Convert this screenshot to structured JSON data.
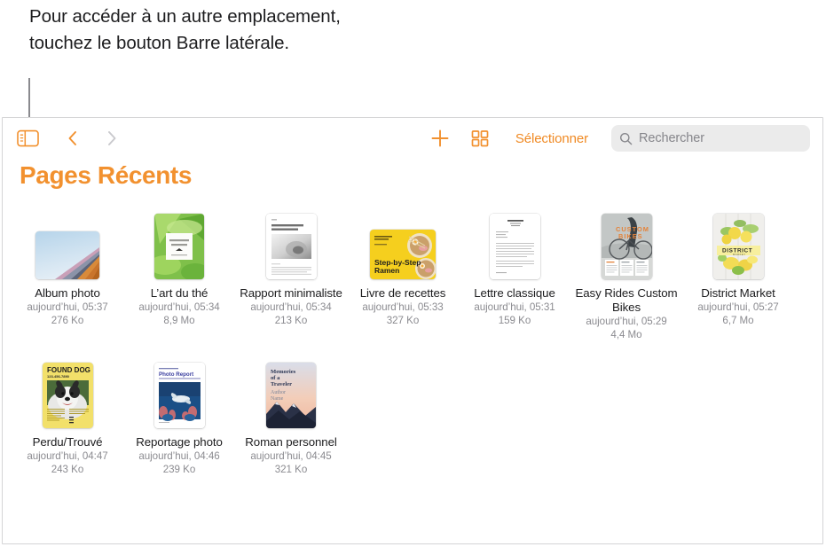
{
  "callout": {
    "text": "Pour accéder à un autre emplacement, touchez le bouton Barre latérale."
  },
  "toolbar": {
    "sidebar_button_label": "Barre latérale",
    "back_label": "Précédent",
    "forward_label": "Suivant",
    "add_label": "Ajouter",
    "view_label": "Affichage",
    "select_label": "Sélectionner",
    "search": {
      "placeholder": "Rechercher",
      "value": ""
    }
  },
  "page": {
    "title": "Pages Récents",
    "accent_color": "#f2912f",
    "search_bg": "#ebebeb"
  },
  "documents": [
    {
      "name": "Album photo",
      "date": "aujourd’hui, 05:37",
      "size": "276 Ko",
      "thumb": "album-photo-thumbnail",
      "orientation": "landscape"
    },
    {
      "name": "L’art du thé",
      "date": "aujourd’hui, 05:34",
      "size": "8,9 Mo",
      "thumb": "art-du-the-thumbnail",
      "orientation": "portrait"
    },
    {
      "name": "Rapport minimaliste",
      "date": "aujourd’hui, 05:34",
      "size": "213 Ko",
      "thumb": "rapport-minimaliste-thumbnail",
      "orientation": "portrait"
    },
    {
      "name": "Livre de recettes",
      "date": "aujourd’hui, 05:33",
      "size": "327 Ko",
      "thumb": "livre-de-recettes-thumbnail",
      "orientation": "landscape"
    },
    {
      "name": "Lettre classique",
      "date": "aujourd’hui, 05:31",
      "size": "159 Ko",
      "thumb": "lettre-classique-thumbnail",
      "orientation": "portrait"
    },
    {
      "name": "Easy Rides Custom Bikes",
      "date": "aujourd’hui, 05:29",
      "size": "4,4 Mo",
      "thumb": "easy-rides-thumbnail",
      "orientation": "portrait"
    },
    {
      "name": "District Market",
      "date": "aujourd’hui, 05:27",
      "size": "6,7 Mo",
      "thumb": "district-market-thumbnail",
      "orientation": "portrait"
    },
    {
      "name": "Perdu/Trouvé",
      "date": "aujourd’hui, 04:47",
      "size": "243 Ko",
      "thumb": "perdu-trouve-thumbnail",
      "orientation": "portrait"
    },
    {
      "name": "Reportage photo",
      "date": "aujourd’hui, 04:46",
      "size": "239 Ko",
      "thumb": "reportage-photo-thumbnail",
      "orientation": "portrait"
    },
    {
      "name": "Roman personnel",
      "date": "aujourd’hui, 04:45",
      "size": "321 Ko",
      "thumb": "roman-personnel-thumbnail",
      "orientation": "portrait"
    }
  ],
  "thumbnail_text": {
    "art_du_the_line1": "The Art",
    "art_du_the_line2": "of Tea",
    "rapport_heading": "ORGANIC FORMS IN ARCHITECTURE",
    "recettes_title": "Step-by-Step Ramen",
    "bikes_title": "CUSTOM BIKES",
    "district_title": "DISTRICT",
    "district_sub": "MARKET",
    "found_dog_title": "FOUND DOG",
    "found_dog_phone": "123-456-7890",
    "photo_report_title": "Photo Report",
    "roman_title": "Memories of a Traveler",
    "roman_author": "Author Name"
  }
}
